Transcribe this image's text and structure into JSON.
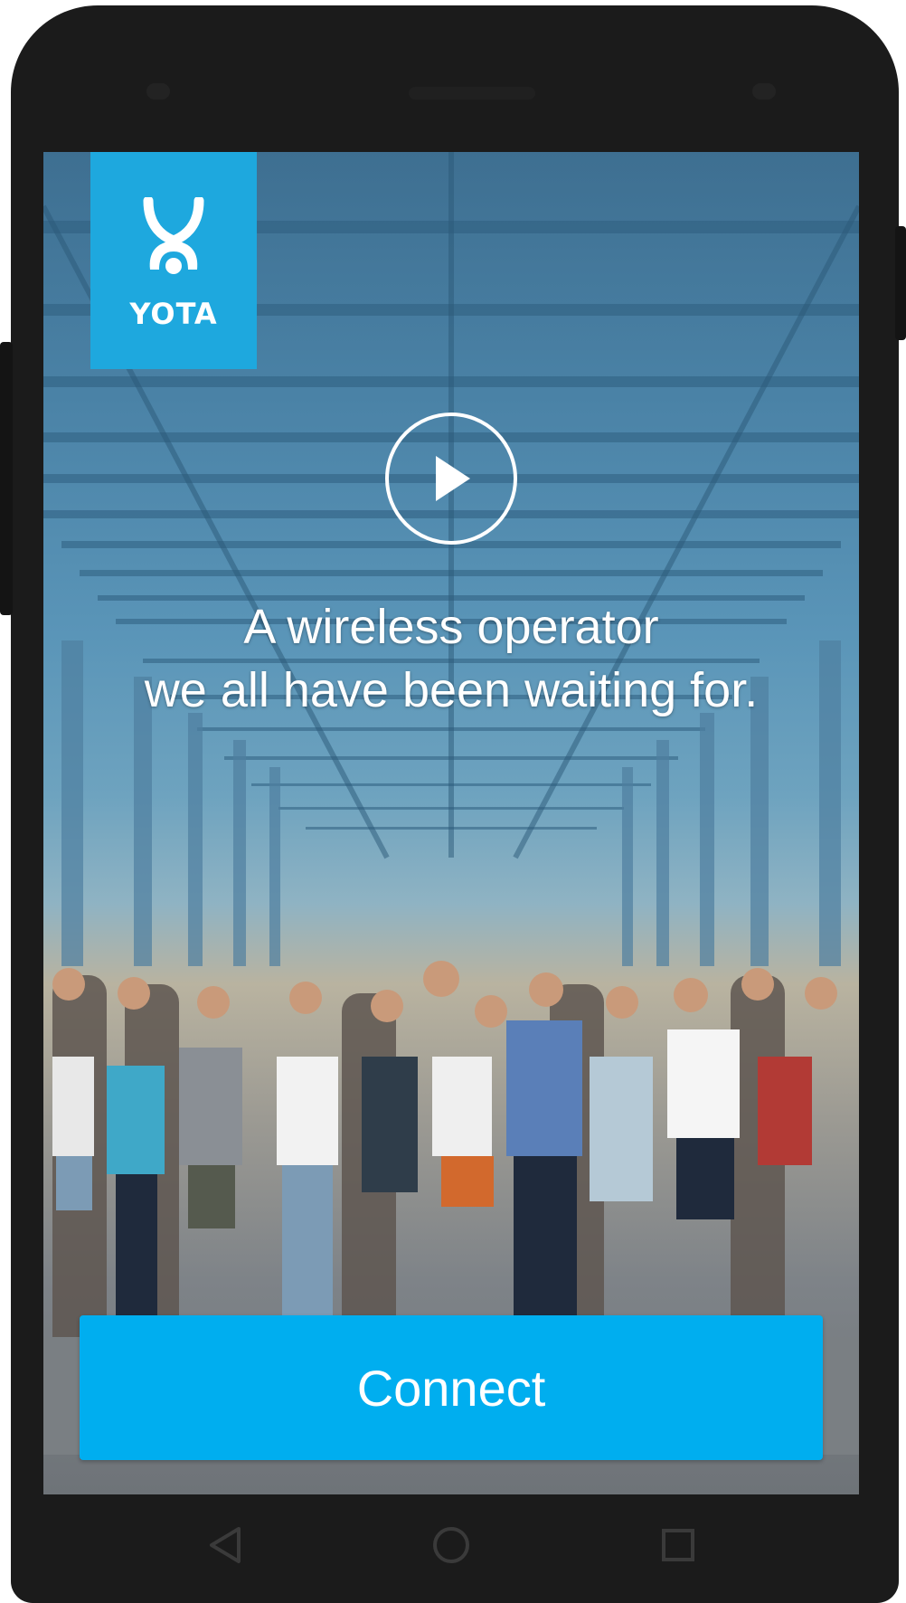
{
  "brand": {
    "logo_text": "YOTA",
    "tile_color": "#1ea8de"
  },
  "hero": {
    "tagline_line1": "A wireless operator",
    "tagline_line2": "we all have been waiting for.",
    "play_icon": "play-icon"
  },
  "actions": {
    "connect_label": "Connect",
    "button_color": "#00aeef"
  },
  "navigation": {
    "back_icon": "back-triangle-icon",
    "home_icon": "home-circle-icon",
    "recent_icon": "recent-apps-square-icon"
  }
}
